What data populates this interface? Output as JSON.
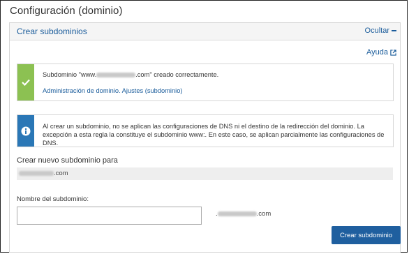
{
  "page": {
    "title": "Configuración (dominio)"
  },
  "panel": {
    "title": "Crear subdominios",
    "collapse_label": "Ocultar",
    "help_label": "Ayuda"
  },
  "success_alert": {
    "prefix": "Subdominio \"www.",
    "suffix": ".com\" creado correctamente.",
    "links": "Administración de dominio. Ajustes (subdominio)"
  },
  "info_alert": {
    "text": "Al crear un subdominio, no se aplican las configuraciones de DNS ni el destino de la redirección del dominio. La excepción a esta regla la constituye el subdominio www:. En este caso, se aplican parcialmente las configuraciones de DNS."
  },
  "new_subdomain": {
    "section_title": "Crear nuevo subdominio para",
    "domain_suffix": ".com",
    "field_label": "Nombre del subdominio:",
    "input_value": "",
    "input_suffix_prefix": ".",
    "input_suffix": ".com",
    "submit_label": "Crear subdominio"
  },
  "colors": {
    "link": "#1a5c9b",
    "success": "#8cc152",
    "info": "#2a77b6",
    "button": "#1f5f9f"
  }
}
